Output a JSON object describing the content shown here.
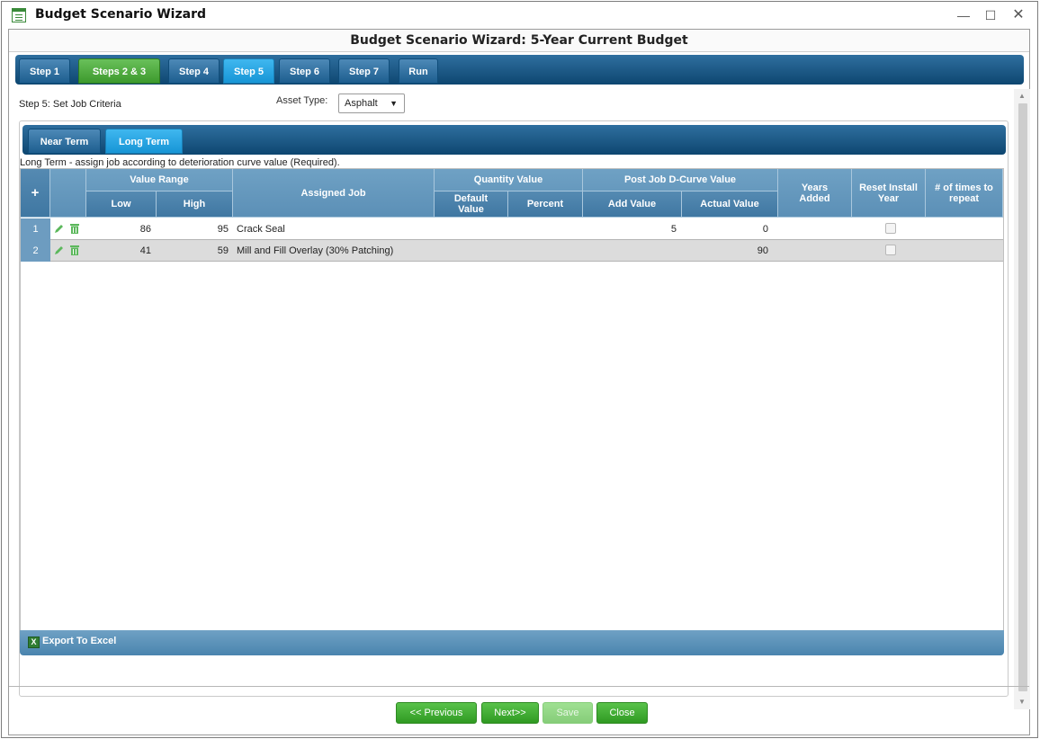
{
  "window": {
    "title": "Budget Scenario Wizard",
    "minimize_label": "—",
    "maximize_label": "☐",
    "close_label": "✕"
  },
  "wizard": {
    "title": "Budget Scenario Wizard: 5-Year Current Budget"
  },
  "step_tabs": [
    {
      "label": "Step 1",
      "state": "normal"
    },
    {
      "label": "Steps 2 & 3",
      "state": "completed"
    },
    {
      "label": "Step 4",
      "state": "normal"
    },
    {
      "label": "Step 5",
      "state": "active"
    },
    {
      "label": "Step 6",
      "state": "normal"
    },
    {
      "label": "Step 7",
      "state": "normal"
    },
    {
      "label": "Run",
      "state": "normal"
    }
  ],
  "step": {
    "label": "Step 5: Set Job Criteria",
    "asset_type_label": "Asset Type:",
    "asset_type_value": "Asphalt"
  },
  "term_tabs": [
    {
      "label": "Near Term",
      "state": "normal"
    },
    {
      "label": "Long Term",
      "state": "active"
    }
  ],
  "description": "Long Term - assign job according to deterioration curve value (Required).",
  "grid": {
    "add_label": "+",
    "headers": {
      "value_range": "Value Range",
      "low": "Low",
      "high": "High",
      "assigned_job": "Assigned Job",
      "quantity_value": "Quantity Value",
      "default_value": "Default Value",
      "percent": "Percent",
      "post_job": "Post Job D-Curve Value",
      "add_value": "Add Value",
      "actual_value": "Actual Value",
      "years_added": "Years Added",
      "reset_install_year": "Reset Install Year",
      "times_to_repeat": "# of times to repeat"
    },
    "rows": [
      {
        "num": "1",
        "low": "86",
        "high": "95",
        "job": "Crack Seal",
        "default_value": "",
        "percent": "",
        "add_value": "5",
        "actual_value": "0",
        "years_added": "",
        "reset_install_year": false,
        "times_to_repeat": ""
      },
      {
        "num": "2",
        "low": "41",
        "high": "59",
        "job": "Mill and Fill Overlay (30% Patching)",
        "default_value": "",
        "percent": "",
        "add_value": "",
        "actual_value": "90",
        "years_added": "",
        "reset_install_year": false,
        "times_to_repeat": ""
      }
    ]
  },
  "export_label": "Export To Excel",
  "buttons": {
    "previous": "<< Previous",
    "next": "Next>>",
    "save": "Save",
    "close": "Close"
  },
  "colors": {
    "accent_blue": "#1795d6",
    "tabbar_blue": "#0d4670",
    "completed_green": "#3d9a2d",
    "button_green": "#2f9a22"
  }
}
